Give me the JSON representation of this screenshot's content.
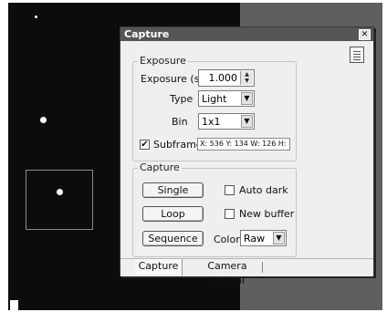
{
  "dialog": {
    "title": "Capture",
    "close_glyph": "✕",
    "pin_icon": "panel-icon"
  },
  "exposure_group": {
    "label": "Exposure",
    "exposure_label": "Exposure (s)",
    "exposure_value": "1.000",
    "type_label": "Type",
    "type_value": "Light",
    "bin_label": "Bin",
    "bin_value": "1x1",
    "subframe_label": "Subframe",
    "subframe_checked": true,
    "subframe_readout": "X: 536 Y: 134 W: 126 H:"
  },
  "capture_group": {
    "label": "Capture",
    "single_button": "Single",
    "loop_button": "Loop",
    "sequence_button": "Sequence",
    "auto_dark_label": "Auto dark",
    "new_buffer_label": "New buffer",
    "color_label": "Color",
    "color_value": "Raw"
  },
  "tabs": [
    {
      "label": "Capture",
      "active": true
    },
    {
      "label": "Camera control",
      "active": false
    }
  ],
  "glyphs": {
    "check": "✔",
    "dropdown": "▼",
    "spin": "▲▼"
  },
  "colors": {
    "image_background": "#0c0c0c",
    "outside_image": "#5f5f5f",
    "titlebar": "#555555",
    "dialog_body": "#efefef"
  }
}
